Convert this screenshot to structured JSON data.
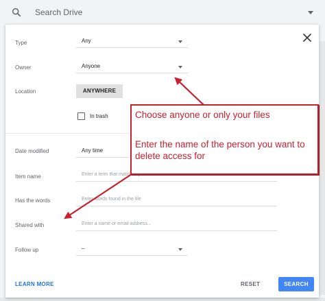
{
  "topbar": {
    "placeholder": "Search Drive",
    "search_icon": "search-icon",
    "dropdown_icon": "caret-down-icon"
  },
  "dialog": {
    "close_icon": "close-icon",
    "type": {
      "label": "Type",
      "value": "Any"
    },
    "owner": {
      "label": "Owner",
      "value": "Anyone"
    },
    "location": {
      "label": "Location",
      "button": "ANYWHERE"
    },
    "trash": {
      "label": "In trash",
      "checked": false
    },
    "date_modified": {
      "label": "Date modified",
      "value": "Any time"
    },
    "item_name": {
      "label": "Item name",
      "placeholder": "Enter a term that matches part of the file name"
    },
    "has_words": {
      "label": "Has the words",
      "placeholder": "Enter words found in the file"
    },
    "shared_with": {
      "label": "Shared with",
      "placeholder": "Enter a name or email address..."
    },
    "follow_up": {
      "label": "Follow up",
      "value": "–"
    },
    "learn_more": "LEARN MORE",
    "reset": "RESET",
    "search": "SEARCH"
  },
  "annotation": {
    "line1": "Choose anyone or only your files",
    "line2": "Enter the name of the person you want to delete access for",
    "color": "#c8202c"
  },
  "colors": {
    "accent": "#1a73e8",
    "search_button": "#4285f4"
  }
}
